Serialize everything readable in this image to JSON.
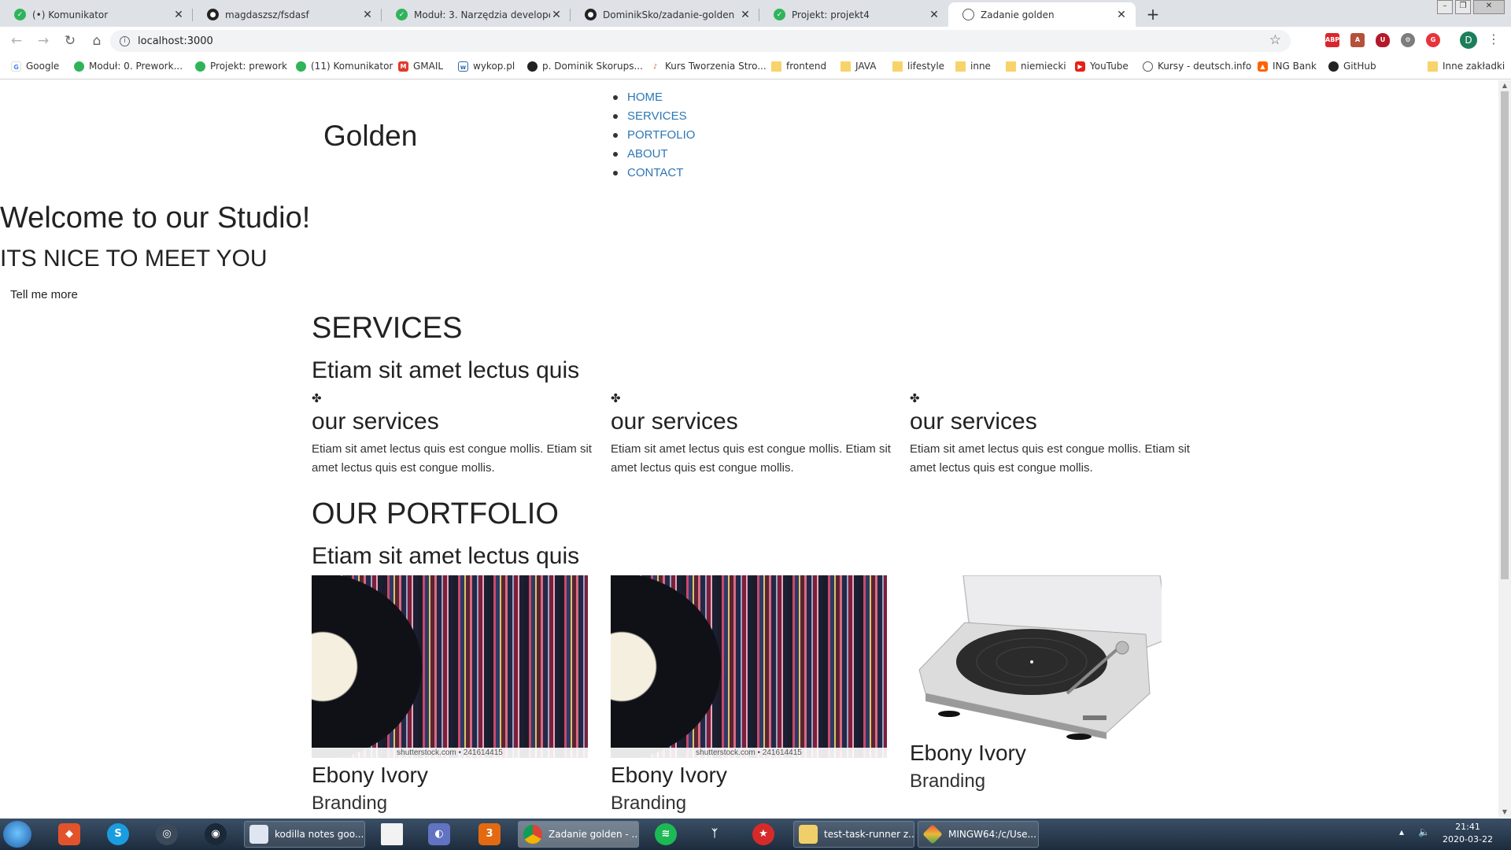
{
  "browser": {
    "tabs": [
      {
        "title": "(•) Komunikator",
        "favicon": "messenger-green-icon"
      },
      {
        "title": "magdaszsz/fsdasf",
        "favicon": "github-icon"
      },
      {
        "title": "Moduł: 3. Narzędzia developerskie",
        "favicon": "kodilla-green-icon"
      },
      {
        "title": "DominikSko/zadanie-golden",
        "favicon": "github-icon"
      },
      {
        "title": "Projekt: projekt4",
        "favicon": "kodilla-green-icon"
      },
      {
        "title": "Zadanie golden",
        "favicon": "globe-icon"
      }
    ],
    "active_tab_index": 5,
    "address": "localhost:3000",
    "profile_initial": "D",
    "bookmarks": [
      {
        "label": "Google",
        "icon": "google-icon"
      },
      {
        "label": "Moduł: 0. Prework...",
        "icon": "kodilla-green-icon"
      },
      {
        "label": "Projekt: prework",
        "icon": "kodilla-green-icon"
      },
      {
        "label": "(11) Komunikator",
        "icon": "messenger-green-icon"
      },
      {
        "label": "GMAIL",
        "icon": "gmail-icon"
      },
      {
        "label": "wykop.pl",
        "icon": "wykop-icon"
      },
      {
        "label": "p. Dominik Skorups...",
        "icon": "github-icon"
      },
      {
        "label": "Kurs Tworzenia Stro...",
        "icon": "kurs-icon"
      },
      {
        "label": "frontend",
        "icon": "folder-icon"
      },
      {
        "label": "JAVA",
        "icon": "folder-icon"
      },
      {
        "label": "lifestyle",
        "icon": "folder-icon"
      },
      {
        "label": "inne",
        "icon": "folder-icon"
      },
      {
        "label": "niemiecki",
        "icon": "folder-icon"
      },
      {
        "label": "YouTube",
        "icon": "youtube-icon"
      },
      {
        "label": "Kursy - deutsch.info",
        "icon": "globe-icon"
      },
      {
        "label": "ING Bank",
        "icon": "ing-icon"
      },
      {
        "label": "GitHub",
        "icon": "github-icon"
      },
      {
        "label": "Inne zakładki",
        "icon": "folder-icon"
      }
    ]
  },
  "page": {
    "logo": "Golden",
    "nav": [
      "HOME",
      "SERVICES",
      "PORTFOLIO",
      "ABOUT",
      "CONTACT"
    ],
    "hero": {
      "title": "Welcome to our Studio!",
      "subtitle": "ITS NICE TO MEET YOU",
      "button": "Tell me more"
    },
    "services": {
      "heading": "SERVICES",
      "subheading": "Etiam sit amet lectus quis",
      "items": [
        {
          "icon": "puzzle-icon",
          "title": "our services",
          "text": "Etiam sit amet lectus quis est congue mollis. Etiam sit amet lectus quis est congue mollis."
        },
        {
          "icon": "puzzle-icon",
          "title": "our services",
          "text": "Etiam sit amet lectus quis est congue mollis. Etiam sit amet lectus quis est congue mollis."
        },
        {
          "icon": "puzzle-icon",
          "title": "our services",
          "text": "Etiam sit amet lectus quis est congue mollis. Etiam sit amet lectus quis est congue mollis."
        }
      ]
    },
    "portfolio": {
      "heading": "OUR PORTFOLIO",
      "subheading": "Etiam sit amet lectus quis",
      "items": [
        {
          "image": "vinyl-records-image",
          "watermark": "shutterstock.com • 241614415",
          "title": "Ebony Ivory",
          "category": "Branding"
        },
        {
          "image": "vinyl-records-image",
          "watermark": "shutterstock.com • 241614415",
          "title": "Ebony Ivory",
          "category": "Branding"
        },
        {
          "image": "turntable-image",
          "watermark": "",
          "title": "Ebony Ivory",
          "category": "Branding"
        }
      ]
    }
  },
  "taskbar": {
    "windows": [
      {
        "label": "kodilla notes goo...",
        "icon": "word-icon"
      },
      {
        "label": "Zadanie golden - ...",
        "icon": "chrome-icon"
      },
      {
        "label": "test-task-runner z...",
        "icon": "folder-icon"
      },
      {
        "label": "MINGW64:/c/Use...",
        "icon": "git-bash-icon"
      }
    ],
    "time": "21:41",
    "date": "2020-03-22"
  },
  "colors": {
    "nav_link": "#2c77b7",
    "tab_strip": "#dee1e6",
    "taskbar": "#1d2c3d"
  }
}
